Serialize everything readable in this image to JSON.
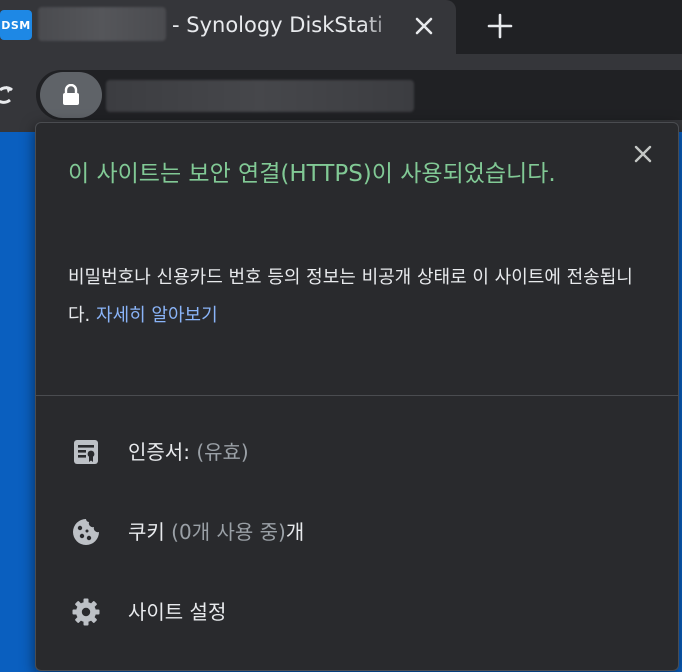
{
  "tab": {
    "favicon_text": "DSM",
    "title": "- Synology DiskStati",
    "close_icon": "close-icon",
    "new_tab_icon": "plus-icon"
  },
  "toolbar": {
    "reload_icon": "reload-icon",
    "site_info_icon": "lock-icon"
  },
  "popup": {
    "title": "이 사이트는 보안 연결(HTTPS)이 사용되었습니다.",
    "description": "비밀번호나 신용카드 번호 등의 정보는 비공개 상태로 이 사이트에 전송됩니다.",
    "learn_more": "자세히 알아보기",
    "certificate": {
      "label": "인증서:",
      "status": "(유효)",
      "icon": "certificate-icon"
    },
    "cookies": {
      "label": "쿠키",
      "count": "(0개 사용 중)",
      "suffix": "개",
      "icon": "cookie-icon"
    },
    "site_settings": {
      "label": "사이트 설정",
      "icon": "gear-icon"
    },
    "close_icon": "close-icon"
  },
  "colors": {
    "title_green": "#81c995",
    "link_blue": "#8ab4f8",
    "popup_bg": "#292a2d",
    "page_bg": "#0b63c7"
  }
}
